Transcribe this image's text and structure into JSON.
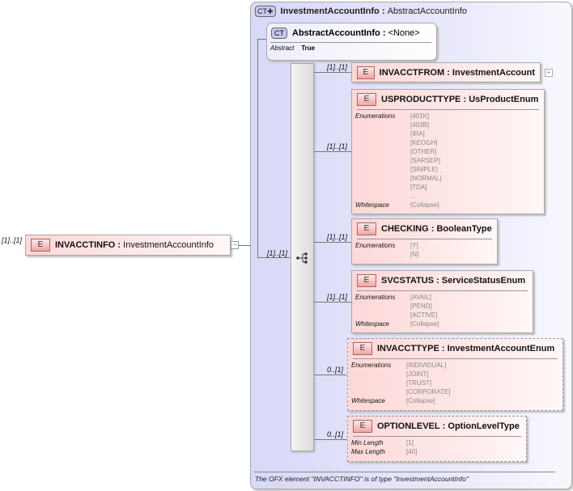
{
  "root": {
    "multiplicity": "[1]..[1]",
    "badge": "E",
    "name": "INVACCTINFO",
    "type": "InvestmentAccountInfo"
  },
  "complex_type": {
    "badge": "CT",
    "name": "InvestmentAccountInfo",
    "base": "AbstractAccountInfo",
    "multiplicity": "[1]..[1]",
    "footer": "The OFX element \"INVACCTINFO\" is of type \"InvestmentAccountInfo\""
  },
  "abstract_type": {
    "badge": "CT",
    "name": "AbstractAccountInfo",
    "base": "<None>",
    "prop_key": "Abstract",
    "prop_value": "True"
  },
  "elements": [
    {
      "mult": "[1]..[1]",
      "badge": "E",
      "name": "INVACCTFROM",
      "type": "InvestmentAccount",
      "props": []
    },
    {
      "mult": "[1]..[1]",
      "badge": "E",
      "name": "USPRODUCTTYPE",
      "type": "UsProductEnum",
      "props": [
        {
          "k": "Enumerations",
          "v": [
            "[401K]",
            "[403B]",
            "[IRA]",
            "[KEOGH]",
            "[OTHER]",
            "[SARSEP]",
            "[SIMPLE]",
            "[NORMAL]",
            "[TDA]",
            "..."
          ]
        },
        {
          "k": "Whitespace",
          "v": [
            "[Collapse]"
          ]
        }
      ]
    },
    {
      "mult": "[1]..[1]",
      "badge": "E",
      "name": "CHECKING",
      "type": "BooleanType",
      "props": [
        {
          "k": "Enumerations",
          "v": [
            "[Y]",
            "[N]"
          ]
        }
      ]
    },
    {
      "mult": "[1]..[1]",
      "badge": "E",
      "name": "SVCSTATUS",
      "type": "ServiceStatusEnum",
      "props": [
        {
          "k": "Enumerations",
          "v": [
            "[AVAIL]",
            "[PEND]",
            "[ACTIVE]"
          ]
        },
        {
          "k": "Whitespace",
          "v": [
            "[Collapse]"
          ]
        }
      ]
    },
    {
      "mult": "0..[1]",
      "badge": "E",
      "name": "INVACCTTYPE",
      "type": "InvestmentAccountEnum",
      "props": [
        {
          "k": "Enumerations",
          "v": [
            "[INDIVIDUAL]",
            "[JOINT]",
            "[TRUST]",
            "[CORPORATE]"
          ]
        },
        {
          "k": "Whitespace",
          "v": [
            "[Collapse]"
          ]
        }
      ]
    },
    {
      "mult": "0..[1]",
      "badge": "E",
      "name": "OPTIONLEVEL",
      "type": "OptionLevelType",
      "props": [
        {
          "k": "Min Length",
          "v": [
            "[1]"
          ]
        },
        {
          "k": "Max Length",
          "v": [
            "[40]"
          ]
        }
      ]
    }
  ]
}
